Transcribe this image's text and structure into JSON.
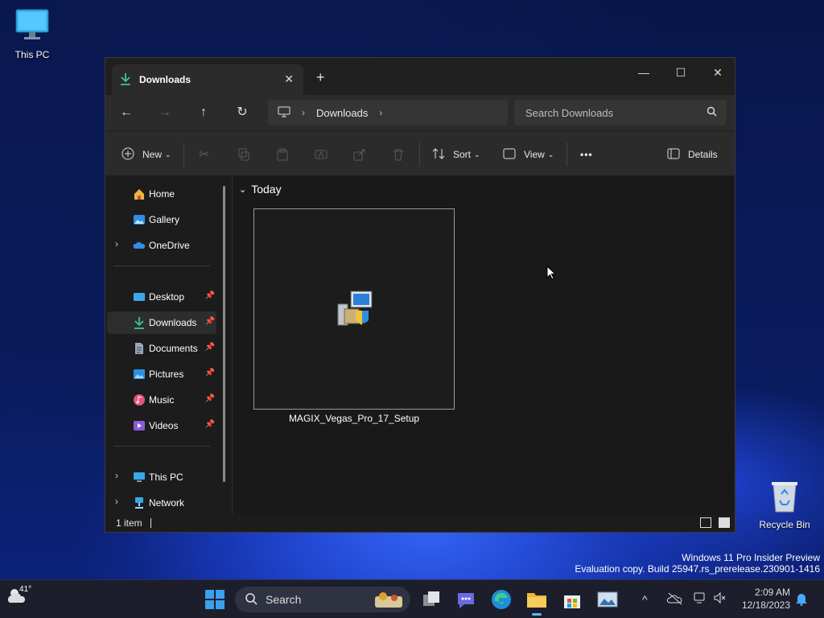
{
  "desktop": {
    "this_pc_label": "This PC",
    "recycle_bin_label": "Recycle Bin",
    "watermark_line1": "Windows 11 Pro Insider Preview",
    "watermark_line2": "Evaluation copy. Build 25947.rs_prerelease.230901-1416"
  },
  "window": {
    "tab_title": "Downloads",
    "tab_close": "✕",
    "new_tab": "+",
    "minimize": "—",
    "maximize": "☐",
    "close": "✕"
  },
  "navbar": {
    "back": "←",
    "forward": "→",
    "up": "↑",
    "refresh": "↻",
    "breadcrumb": [
      "Downloads"
    ],
    "search_placeholder": "Search Downloads"
  },
  "toolbar": {
    "new_label": "New",
    "sort_label": "Sort",
    "view_label": "View",
    "more_label": "•••",
    "details_label": "Details"
  },
  "sidebar": {
    "items": [
      {
        "label": "Home",
        "icon": "home-icon"
      },
      {
        "label": "Gallery",
        "icon": "gallery-icon"
      },
      {
        "label": "OneDrive",
        "icon": "onedrive-icon"
      },
      {
        "label": "Desktop",
        "icon": "desktop-icon",
        "pinned": true
      },
      {
        "label": "Downloads",
        "icon": "downloads-icon",
        "pinned": true,
        "selected": true
      },
      {
        "label": "Documents",
        "icon": "documents-icon",
        "pinned": true
      },
      {
        "label": "Pictures",
        "icon": "pictures-icon",
        "pinned": true
      },
      {
        "label": "Music",
        "icon": "music-icon",
        "pinned": true
      },
      {
        "label": "Videos",
        "icon": "videos-icon",
        "pinned": true
      },
      {
        "label": "This PC",
        "icon": "this-pc-icon"
      },
      {
        "label": "Network",
        "icon": "network-icon"
      }
    ]
  },
  "content": {
    "group_header": "Today",
    "files": [
      {
        "name": "MAGIX_Vegas_Pro_17_Setup",
        "icon": "installer-icon"
      }
    ]
  },
  "status": {
    "item_count": "1 item"
  },
  "taskbar": {
    "weather_temp": "41°",
    "search_label": "Search",
    "time": "2:09 AM",
    "date": "12/18/2023"
  }
}
